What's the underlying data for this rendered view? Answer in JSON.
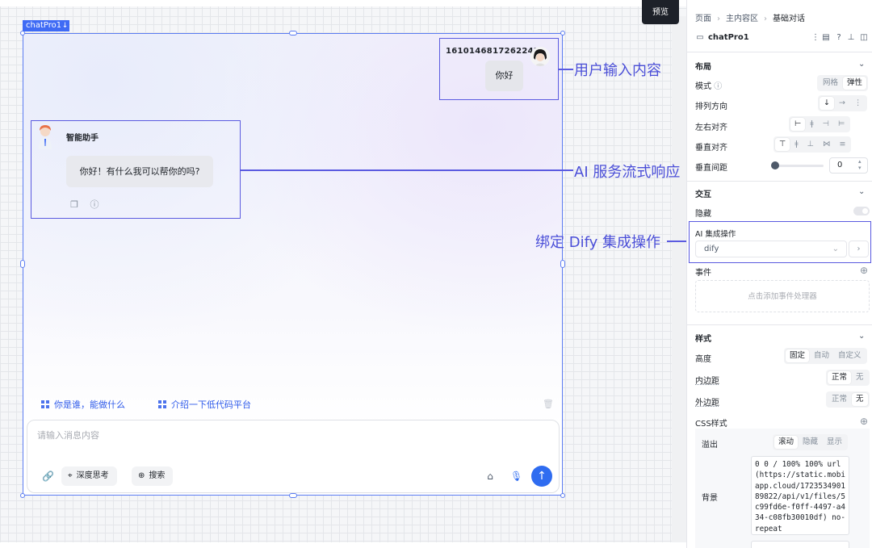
{
  "canvas": {
    "preview_label": "预览",
    "component_tag": "chatPro1",
    "user_message": {
      "name": "1610146817262242",
      "text": "你好"
    },
    "ai_message": {
      "name": "智能助手",
      "text": "你好！有什么我可以帮你的吗?"
    },
    "suggestions": [
      "你是谁，能做什么",
      "介绍一下低代码平台"
    ],
    "input": {
      "placeholder": "请输入消息内容",
      "deep_think": "深度思考",
      "search": "搜索"
    },
    "annotations": {
      "user_input": "用户输入内容",
      "ai_stream": "AI 服务流式响应",
      "dify_bind": "绑定 Dify 集成操作"
    }
  },
  "panel": {
    "breadcrumb": [
      "页面",
      "主内容区",
      "基础对话"
    ],
    "component_name": "chatPro1",
    "layout": {
      "title": "布局",
      "mode_label": "模式",
      "mode_options": [
        "网格",
        "弹性"
      ],
      "direction_label": "排列方向",
      "halign_label": "左右对齐",
      "valign_label": "垂直对齐",
      "vgap_label": "垂直间距",
      "vgap_value": "0"
    },
    "interaction": {
      "title": "交互",
      "hidden_label": "隐藏",
      "ai_label": "AI 集成操作",
      "ai_value": "dify",
      "events_label": "事件",
      "events_placeholder": "点击添加事件处理器"
    },
    "style": {
      "title": "样式",
      "height_label": "高度",
      "height_options": [
        "固定",
        "自动",
        "自定义"
      ],
      "padding_label": "内边距",
      "padding_options": [
        "正常",
        "无"
      ],
      "margin_label": "外边距",
      "margin_options": [
        "正常",
        "无"
      ],
      "css_label": "CSS样式",
      "overflow_label": "溢出",
      "overflow_options": [
        "滚动",
        "隐藏",
        "显示"
      ],
      "bg_label": "背景",
      "bg_value": "0 0 / 100% 100% url(https://static.mobiapp.cloud/172353490189822/api/v1/files/5c99fd6e-f0ff-4497-a434-c08fb30010df) no-repeat"
    }
  }
}
